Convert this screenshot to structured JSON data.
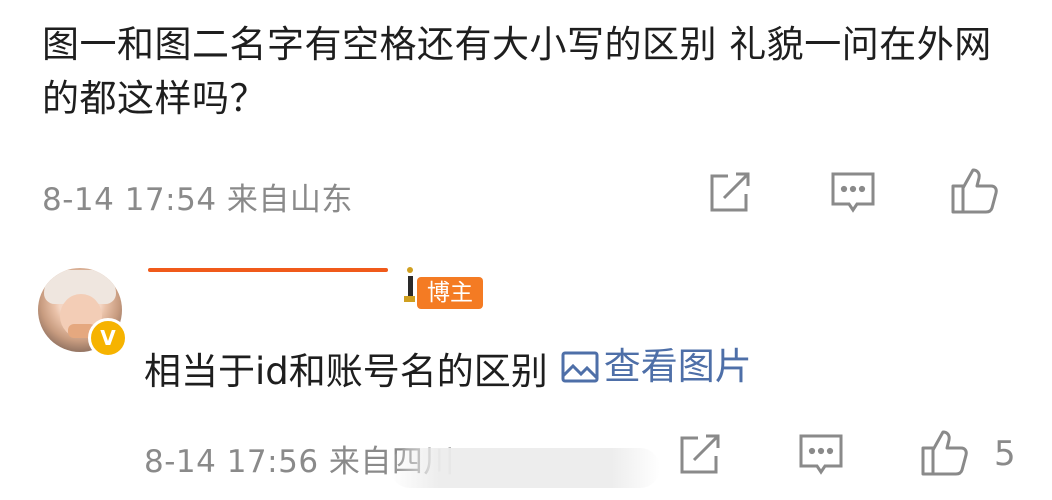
{
  "comment": {
    "text": "图一和图二名字有空格还有大小写的区别 礼貌一问在外网的都这样吗？",
    "meta": "8-14 17:54 来自山东"
  },
  "reply": {
    "badge": "博主",
    "verified_badge": "V",
    "text": "相当于id和账号名的区别",
    "pic_link": "查看图片",
    "meta": "8-14 17:56 来自四川",
    "likes": "5"
  },
  "icons": [
    "share-icon",
    "comment-icon",
    "like-icon",
    "image-icon"
  ],
  "colors": {
    "link": "#4e6fa8",
    "badge": "#f47b23",
    "verified": "#f6b300",
    "meta": "#8a8a8a"
  }
}
